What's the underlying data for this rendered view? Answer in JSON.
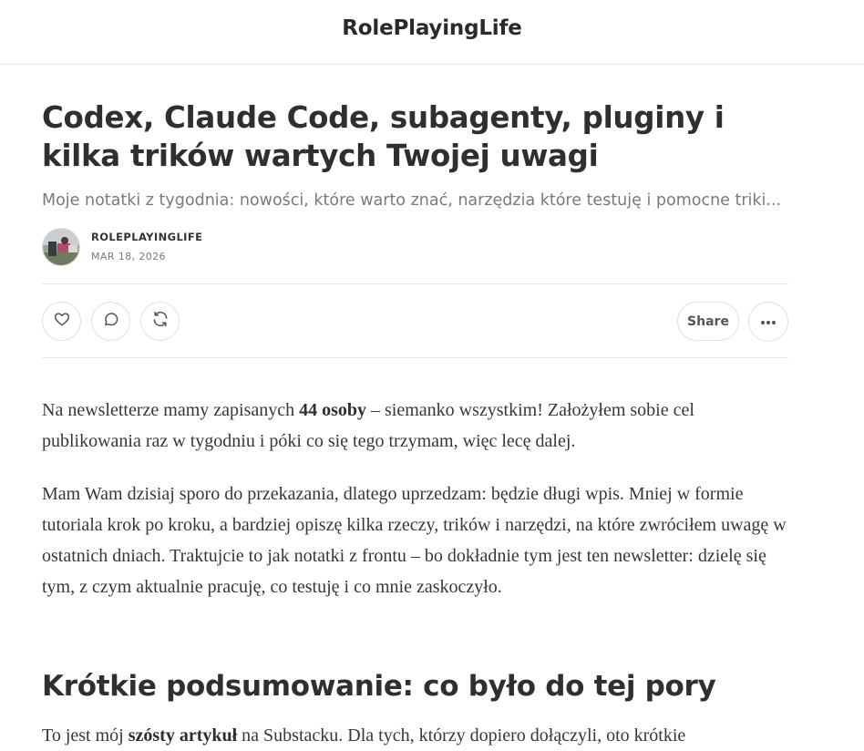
{
  "header": {
    "publication_name": "RolePlayingLife"
  },
  "post": {
    "title": "Codex, Claude Code, subagenty, pluginy i kilka trików wartych Twojej uwagi",
    "subtitle": "Moje notatki z tygodnia: nowości, które warto znać, narzędzia które testuję i pomocne triki...",
    "author": "ROLEPLAYINGLIFE",
    "date": "MAR 18, 2026"
  },
  "actions": {
    "like_icon": "heart-icon",
    "comment_icon": "comment-icon",
    "restack_icon": "restack-icon",
    "share_label": "Share",
    "more_icon": "more-icon"
  },
  "content": {
    "p1_before": "Na newsletterze mamy zapisanych ",
    "p1_bold": "44 osoby",
    "p1_after": " – siemanko wszystkim! Założyłem sobie cel publikowania raz w tygodniu i póki co się tego trzymam, więc lecę dalej.",
    "p2": "Mam Wam dzisiaj sporo do przekazania, dlatego uprzedzam: będzie długi wpis. Mniej w formie tutoriala krok po kroku, a bardziej opiszę kilka rzeczy, trików i narzędzi, na które zwróciłem uwagę w ostatnich dniach. Traktujcie to jak notatki z frontu – bo dokładnie tym jest ten newsletter: dzielę się tym, z czym aktualnie pracuję, co testuję i co mnie zaskoczyło.",
    "heading": "Krótkie podsumowanie: co było do tej pory",
    "p3_before": "To jest mój ",
    "p3_bold": "szósty artykuł",
    "p3_after": " na Substacku. Dla tych, którzy dopiero dołączyli, oto krótkie"
  },
  "colors": {
    "text": "#363737",
    "muted": "#7a7a7a",
    "border": "#e6e6e6"
  }
}
